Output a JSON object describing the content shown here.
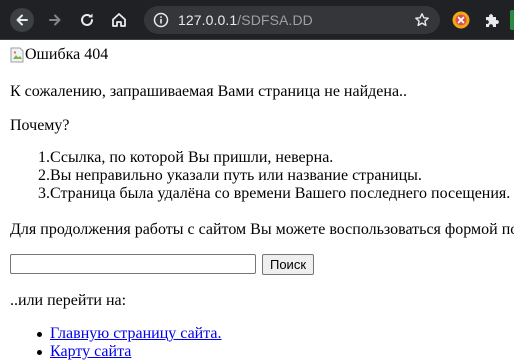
{
  "browser": {
    "url_host": "127.0.0.1",
    "url_path": "/SDFSA.DD"
  },
  "page": {
    "broken_image_alt": "Ошибка 404",
    "sorry_text": "К сожалению, запрашиваемая Вами страница не найдена..",
    "why_text": "Почему?",
    "reasons": [
      {
        "num": "1.",
        "text": "Ссылка, по которой Вы пришли, неверна."
      },
      {
        "num": "2.",
        "text": "Вы неправильно указали путь или название страницы."
      },
      {
        "num": "3.",
        "text": "Страница была удалёна со времени Вашего последнего посещения."
      }
    ],
    "continue_text": "Для продолжения работы с сайтом Вы можете воспользоваться формой по",
    "search": {
      "value": "",
      "button_label": "Поиск"
    },
    "or_goto_text": "..или перейти на:",
    "links": [
      {
        "label": "Главную страницу сайта."
      },
      {
        "label": "Карту сайта"
      }
    ]
  }
}
